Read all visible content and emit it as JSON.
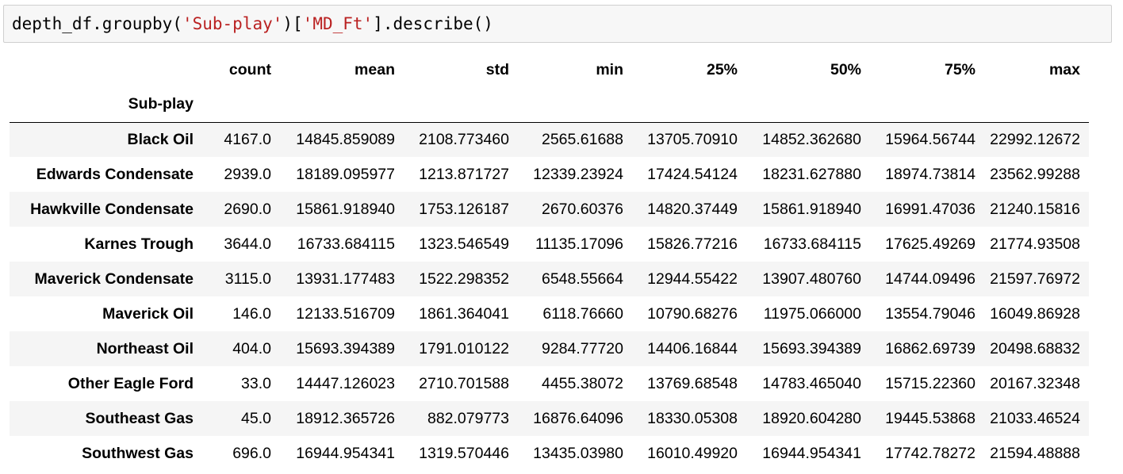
{
  "code": {
    "prefix": "depth_df.groupby(",
    "arg1": "'Sub-play'",
    "middle": ")[",
    "arg2": "'MD_Ft'",
    "suffix": "].describe()"
  },
  "table": {
    "columns": [
      "count",
      "mean",
      "std",
      "min",
      "25%",
      "50%",
      "75%",
      "max"
    ],
    "index_name": "Sub-play",
    "rows": [
      {
        "label": "Black Oil",
        "values": [
          "4167.0",
          "14845.859089",
          "2108.773460",
          "2565.61688",
          "13705.70910",
          "14852.362680",
          "15964.56744",
          "22992.12672"
        ]
      },
      {
        "label": "Edwards Condensate",
        "values": [
          "2939.0",
          "18189.095977",
          "1213.871727",
          "12339.23924",
          "17424.54124",
          "18231.627880",
          "18974.73814",
          "23562.99288"
        ]
      },
      {
        "label": "Hawkville Condensate",
        "values": [
          "2690.0",
          "15861.918940",
          "1753.126187",
          "2670.60376",
          "14820.37449",
          "15861.918940",
          "16991.47036",
          "21240.15816"
        ]
      },
      {
        "label": "Karnes Trough",
        "values": [
          "3644.0",
          "16733.684115",
          "1323.546549",
          "11135.17096",
          "15826.77216",
          "16733.684115",
          "17625.49269",
          "21774.93508"
        ]
      },
      {
        "label": "Maverick Condensate",
        "values": [
          "3115.0",
          "13931.177483",
          "1522.298352",
          "6548.55664",
          "12944.55422",
          "13907.480760",
          "14744.09496",
          "21597.76972"
        ]
      },
      {
        "label": "Maverick Oil",
        "values": [
          "146.0",
          "12133.516709",
          "1861.364041",
          "6118.76660",
          "10790.68276",
          "11975.066000",
          "13554.79046",
          "16049.86928"
        ]
      },
      {
        "label": "Northeast Oil",
        "values": [
          "404.0",
          "15693.394389",
          "1791.010122",
          "9284.77720",
          "14406.16844",
          "15693.394389",
          "16862.69739",
          "20498.68832"
        ]
      },
      {
        "label": "Other Eagle Ford",
        "values": [
          "33.0",
          "14447.126023",
          "2710.701588",
          "4455.38072",
          "13769.68548",
          "14783.465040",
          "15715.22360",
          "20167.32348"
        ]
      },
      {
        "label": "Southeast Gas",
        "values": [
          "45.0",
          "18912.365726",
          "882.079773",
          "16876.64096",
          "18330.05308",
          "18920.604280",
          "19445.53868",
          "21033.46524"
        ]
      },
      {
        "label": "Southwest Gas",
        "values": [
          "696.0",
          "16944.954341",
          "1319.570446",
          "13435.03980",
          "16010.49920",
          "16944.954341",
          "17742.78272",
          "21594.48888"
        ]
      }
    ]
  }
}
